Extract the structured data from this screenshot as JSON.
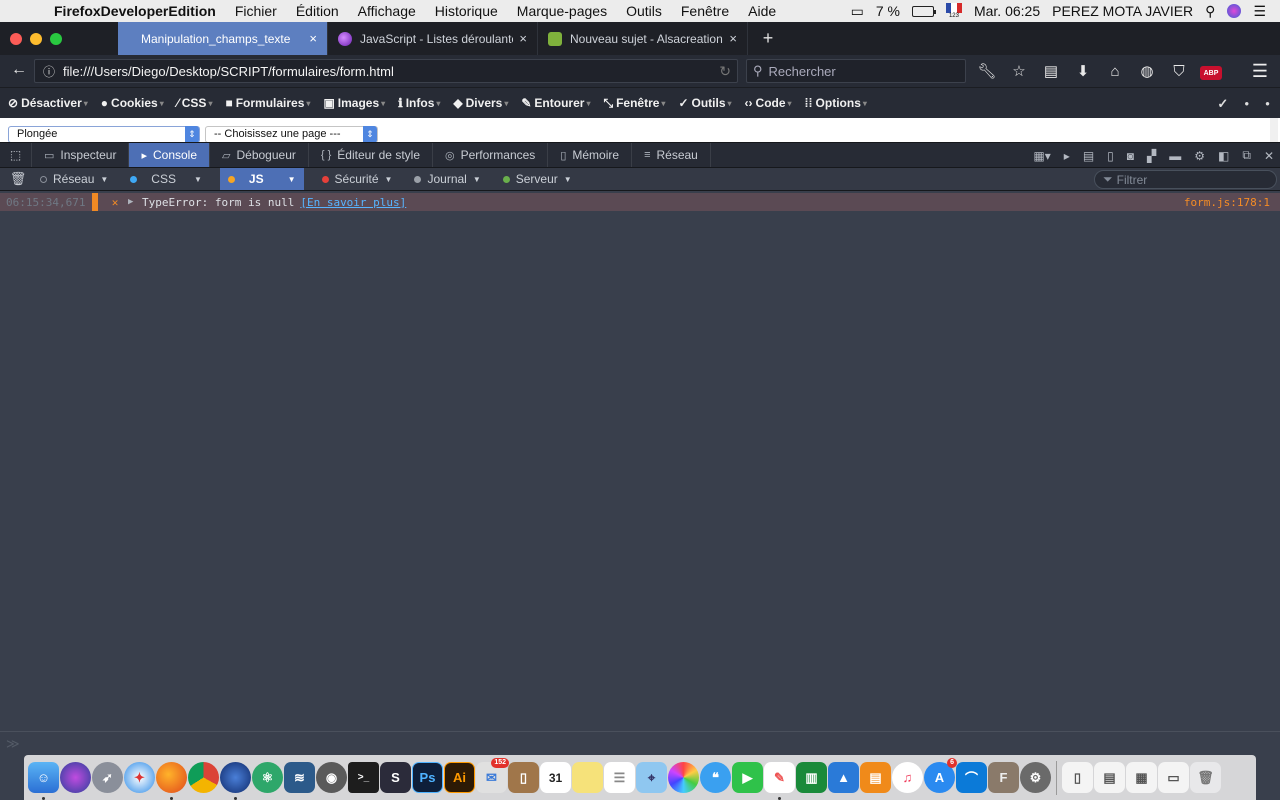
{
  "menubar": {
    "app_name": "FirefoxDeveloperEdition",
    "items": [
      "Fichier",
      "Édition",
      "Affichage",
      "Historique",
      "Marque-pages",
      "Outils",
      "Fenêtre",
      "Aide"
    ],
    "battery_percent": "7 %",
    "clock": "Mar. 06:25",
    "user": "PEREZ MOTA JAVIER",
    "input_source": "123"
  },
  "tabs": [
    {
      "label": "Manipulation_champs_texte",
      "active": true,
      "close": "×"
    },
    {
      "label": "JavaScript - Listes déroulante",
      "active": false,
      "close": "×",
      "icon_color": "#8a3fd1"
    },
    {
      "label": "Nouveau sujet - Alsacreations",
      "active": false,
      "close": "×",
      "icon_color": "#7fb13c"
    }
  ],
  "new_tab_label": "+",
  "navbar": {
    "url": "file:///Users/Diego/Desktop/SCRIPT/formulaires/form.html",
    "search_placeholder": "Rechercher",
    "abp_label": "ABP"
  },
  "webdev_toolbar": [
    {
      "label": "Désactiver",
      "icon": "no-entry-icon"
    },
    {
      "label": "Cookies",
      "icon": "user-icon"
    },
    {
      "label": "CSS",
      "icon": "wand-icon"
    },
    {
      "label": "Formulaires",
      "icon": "briefcase-icon"
    },
    {
      "label": "Images",
      "icon": "image-icon"
    },
    {
      "label": "Infos",
      "icon": "info-icon"
    },
    {
      "label": "Divers",
      "icon": "cube-icon"
    },
    {
      "label": "Entourer",
      "icon": "pen-icon"
    },
    {
      "label": "Fenêtre",
      "icon": "resize-icon"
    },
    {
      "label": "Outils",
      "icon": "wrench-icon"
    },
    {
      "label": "Code",
      "icon": "code-icon"
    },
    {
      "label": "Options",
      "icon": "settings-icon"
    }
  ],
  "page": {
    "select1_value": "Plongée",
    "select2_value": "-- Choisissez une page ---"
  },
  "devtools": {
    "tabs": [
      {
        "label": "Inspecteur",
        "icon": "inspector-icon"
      },
      {
        "label": "Console",
        "icon": "console-icon",
        "active": true
      },
      {
        "label": "Débogueur",
        "icon": "debugger-icon"
      },
      {
        "label": "Éditeur de style",
        "icon": "style-editor-icon"
      },
      {
        "label": "Performances",
        "icon": "performance-icon"
      },
      {
        "label": "Mémoire",
        "icon": "memory-icon"
      },
      {
        "label": "Réseau",
        "icon": "network-icon"
      }
    ],
    "filters": [
      {
        "label": "Réseau",
        "dot_color": "#8a8f99"
      },
      {
        "label": "CSS",
        "dot_color": "#3fa9f5"
      },
      {
        "label": "JS",
        "dot_color": "#f6a524",
        "active": true
      },
      {
        "label": "Sécurité",
        "dot_color": "#e5403a"
      },
      {
        "label": "Journal",
        "dot_color": "#9aa0a8"
      },
      {
        "label": "Serveur",
        "dot_color": "#6ab04c"
      }
    ],
    "filter_placeholder": "Filtrer",
    "log": {
      "timestamp": "06:15:34,671",
      "level": "error",
      "message": "TypeError: form is null",
      "learn_more": "[En savoir plus]",
      "location": "form.js:178:1"
    },
    "input_prompt": "≫"
  },
  "dock": {
    "calendar_day": "31",
    "mail_badge": "152",
    "appstore_badge": "6"
  },
  "colors": {
    "accent": "#5d7fc0",
    "devtools_active": "#4d6fb5",
    "error": "#f58c25",
    "error_row_bg": "#5b4a54"
  }
}
